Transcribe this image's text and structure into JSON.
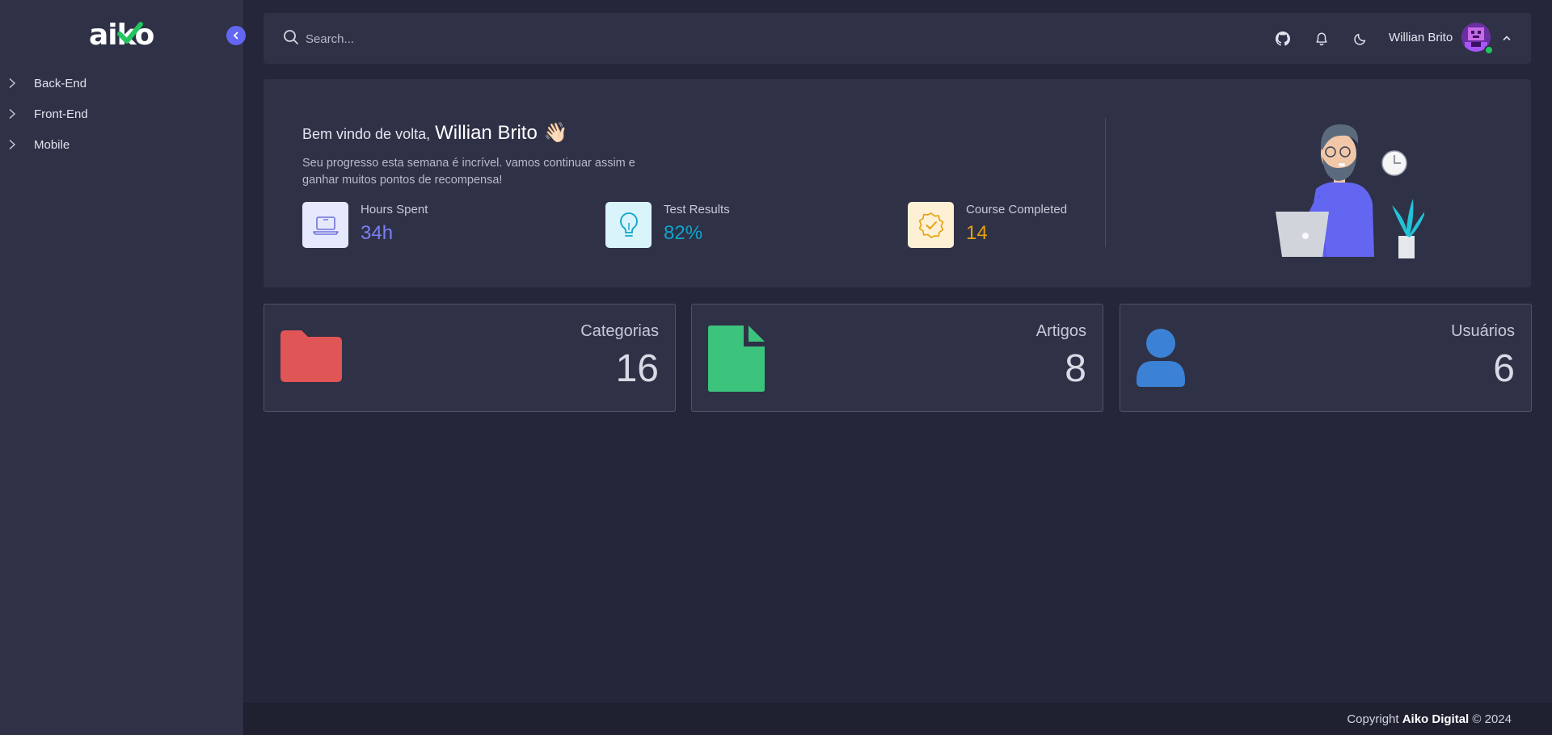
{
  "brand": {
    "logo_text": "aiko"
  },
  "sidebar": {
    "items": [
      {
        "label": "Back-End"
      },
      {
        "label": "Front-End"
      },
      {
        "label": "Mobile"
      }
    ]
  },
  "header": {
    "search_placeholder": "Search...",
    "user_name": "Willian Brito",
    "icons": [
      "github-icon",
      "bell-icon",
      "moon-icon"
    ]
  },
  "welcome": {
    "greeting_prefix": "Bem vindo de volta,",
    "greeting_name": "Willian Brito",
    "wave_emoji": "👋🏻",
    "subtitle": "Seu progresso esta semana é incrível. vamos continuar assim e ganhar muitos pontos de recompensa!",
    "stats": [
      {
        "label": "Hours Spent",
        "value": "34h",
        "icon": "laptop-icon",
        "color": "#7c7ff5"
      },
      {
        "label": "Test Results",
        "value": "82%",
        "icon": "lightbulb-icon",
        "color": "#0ea5c9"
      },
      {
        "label": "Course Completed",
        "value": "14",
        "icon": "badge-check-icon",
        "color": "#e5a00d"
      }
    ]
  },
  "cards": [
    {
      "title": "Categorias",
      "value": "16",
      "icon": "folder-icon",
      "color": "#e05555"
    },
    {
      "title": "Artigos",
      "value": "8",
      "icon": "file-icon",
      "color": "#3cc47c"
    },
    {
      "title": "Usuários",
      "value": "6",
      "icon": "user-icon",
      "color": "#3b82d6"
    }
  ],
  "footer": {
    "prefix": "Copyright",
    "company": "Aiko Digital",
    "suffix": "© 2024"
  },
  "colors": {
    "accent": "#6366f1",
    "sidebar_bg": "#2f3146",
    "page_bg": "#26263a"
  }
}
